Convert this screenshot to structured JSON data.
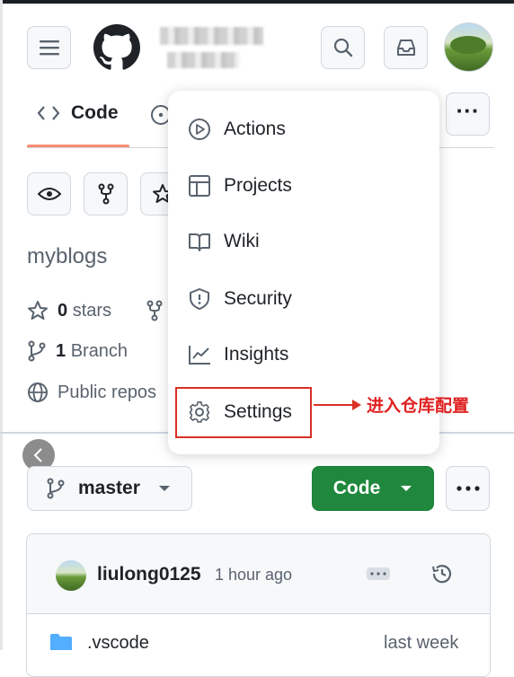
{
  "header": {
    "menu_icon": "hamburger-icon",
    "logo_icon": "github-mark-icon",
    "search_icon": "search-icon",
    "inbox_icon": "inbox-icon"
  },
  "tabs": {
    "code_label": "Code",
    "more_label": "···"
  },
  "repo": {
    "name": "myblogs",
    "stars_count": "0",
    "stars_label": "stars",
    "branch_count": "1",
    "branch_label": "Branch",
    "visibility": "Public repos"
  },
  "menu": {
    "items": [
      {
        "label": "Actions",
        "icon": "play-icon"
      },
      {
        "label": "Projects",
        "icon": "table-icon"
      },
      {
        "label": "Wiki",
        "icon": "book-icon"
      },
      {
        "label": "Security",
        "icon": "shield-icon"
      },
      {
        "label": "Insights",
        "icon": "graph-icon"
      },
      {
        "label": "Settings",
        "icon": "gear-icon"
      }
    ]
  },
  "annotation": {
    "text": "进入仓库配置",
    "color": "#e02020"
  },
  "toolbar": {
    "branch": "master",
    "code_button": "Code",
    "code_button_color": "#1f883d"
  },
  "commit": {
    "author": "liulong0125",
    "time": "1 hour ago"
  },
  "files": [
    {
      "name": ".vscode",
      "updated": "last week"
    }
  ]
}
